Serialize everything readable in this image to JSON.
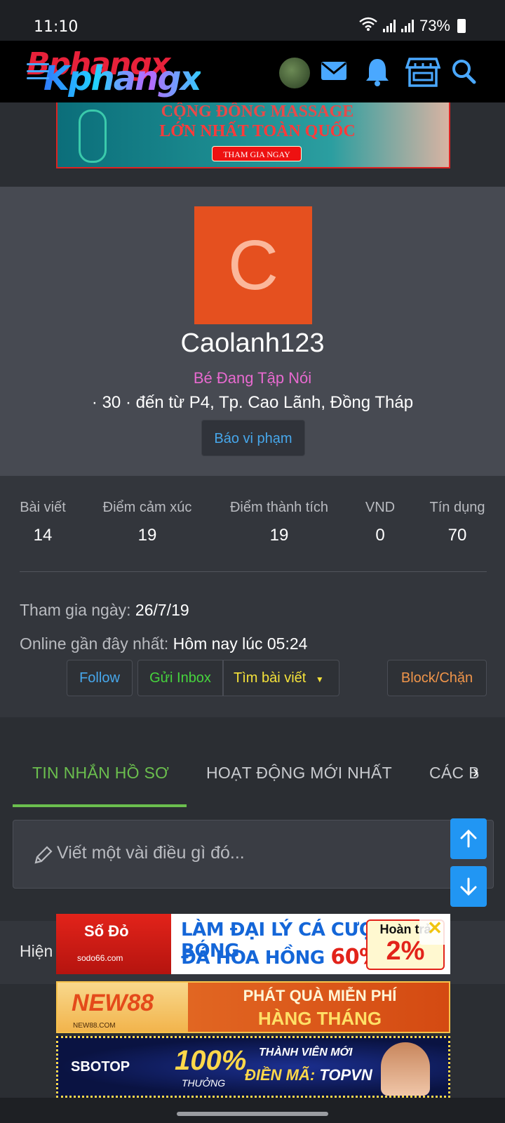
{
  "status_bar": {
    "time": "11:10",
    "battery": "73%"
  },
  "topbar": {
    "logo_back": "Bphangx",
    "logo_front": "Kphangx",
    "logo_x": "x"
  },
  "banner_top": {
    "line1": "CỘNG ĐỒNG MASSAGE",
    "line2": "LỚN NHẤT TOÀN QUỐC",
    "cta": "THAM GIA NGAY"
  },
  "profile": {
    "avatar_letter": "C",
    "username": "Caolanh123",
    "rank": "Bé Đang Tập Nói",
    "location": "· 30 · đến từ P4, Tp. Cao Lãnh, Đồng Tháp",
    "report_label": "Báo vi phạm"
  },
  "stats": [
    {
      "label": "Bài viết",
      "value": "14"
    },
    {
      "label": "Điểm cảm xúc",
      "value": "19"
    },
    {
      "label": "Điểm thành tích",
      "value": "19"
    },
    {
      "label": "VND",
      "value": "0"
    },
    {
      "label": "Tín dụng",
      "value": "70"
    }
  ],
  "info": {
    "joined_label": "Tham gia ngày:",
    "joined_value": "26/7/19",
    "online_label": "Online gần đây nhất:",
    "online_value": "Hôm nay lúc 05:24"
  },
  "actions": {
    "follow": "Follow",
    "inbox": "Gửi Inbox",
    "find_posts": "Tìm bài viết",
    "block": "Block/Chặn"
  },
  "tabs": [
    {
      "label": "TIN NHẮN HỒ SƠ",
      "active": true
    },
    {
      "label": "HOẠT ĐỘNG MỚI NHẤT",
      "active": false
    },
    {
      "label": "CÁC B",
      "active": false
    }
  ],
  "composer": {
    "placeholder": "Viết một vài điều gì đó..."
  },
  "bottom": {
    "label": "Hiện"
  },
  "ads": {
    "ad1": {
      "brand": "Số Đỏ",
      "brand_sub": "sodo66.com",
      "line1": "LÀM ĐẠI LÝ CÁ CƯỢC BÓNG",
      "line2": "ĐÁ HOA HỒNG",
      "pct": "60%",
      "right_title": "Hoàn trả",
      "right_pct": "2%"
    },
    "ad2": {
      "brand": "NEW88",
      "brand_sub": "NEW88.COM",
      "line1": "PHÁT QUÀ MIỄN PHÍ",
      "line2": "HÀNG THÁNG"
    },
    "ad3": {
      "brand": "SBOTOP",
      "big": "100%",
      "small": "THƯỞNG",
      "r1": "THÀNH VIÊN MỚI",
      "r2_label": "ĐIỀN MÃ:",
      "r2_code": "TOPVN"
    }
  },
  "colors": {
    "accent_blue": "#2196f3",
    "tab_active": "#6bbf4e",
    "avatar_bg": "#e5501f",
    "rank_pink": "#e86ad0"
  }
}
